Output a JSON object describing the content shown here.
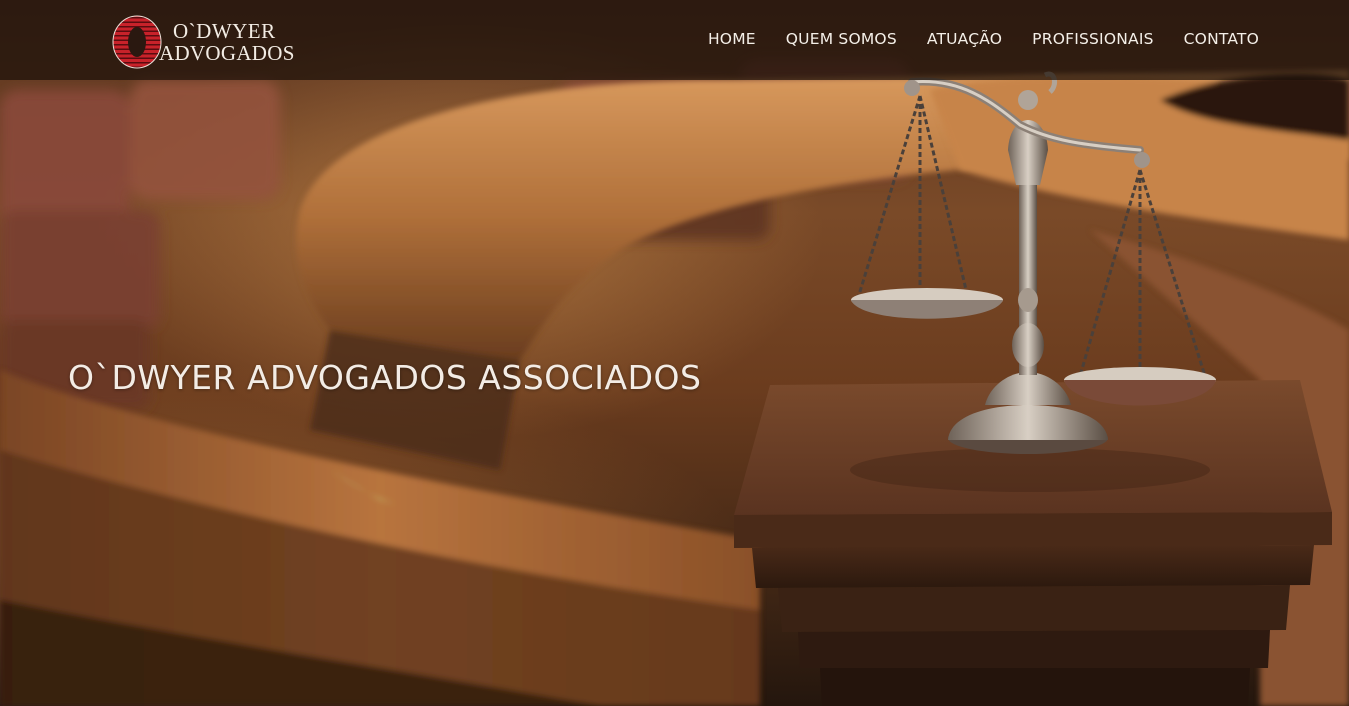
{
  "brand": {
    "line1": "O`DWYER",
    "line2": "ADVOGADOS",
    "accent": "#c8222a"
  },
  "nav": {
    "items": [
      {
        "label": "HOME"
      },
      {
        "label": "QUEM SOMOS"
      },
      {
        "label": "ATUAÇÃO"
      },
      {
        "label": "PROFISSIONAIS"
      },
      {
        "label": "CONTATO"
      }
    ]
  },
  "hero": {
    "title": "O`DWYER ADVOGADOS ASSOCIADOS",
    "image": "courtroom-scales-of-justice"
  }
}
